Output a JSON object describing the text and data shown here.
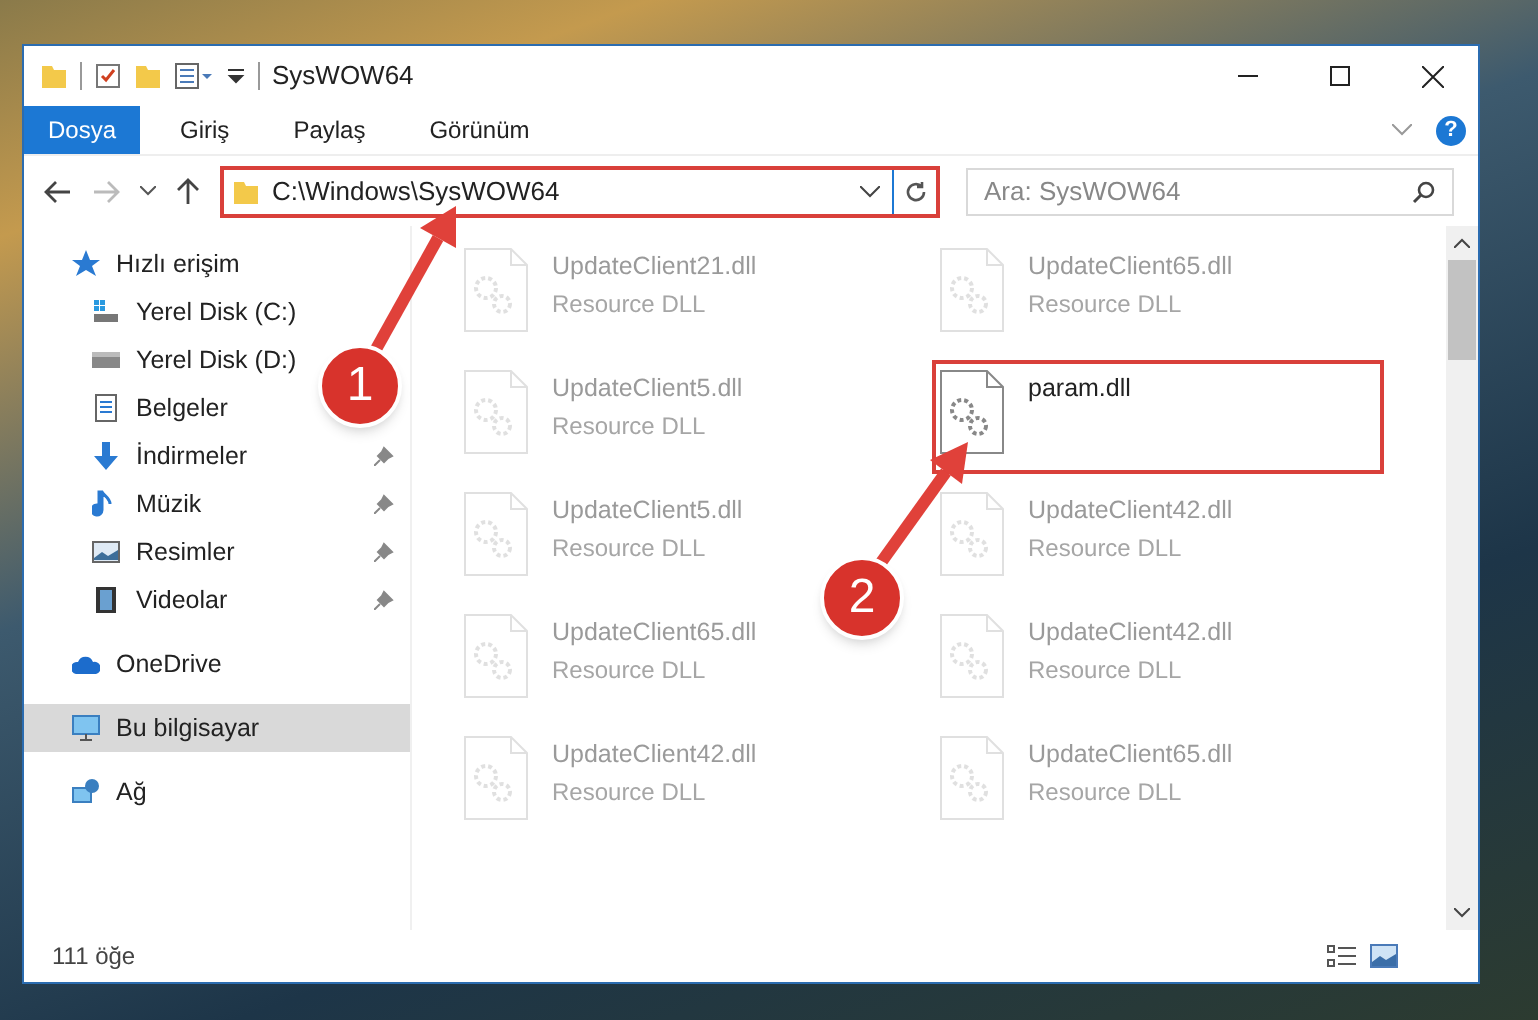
{
  "window": {
    "title": "SysWOW64"
  },
  "ribbon": {
    "tabs": [
      {
        "label": "Dosya",
        "selected": true
      },
      {
        "label": "Giriş",
        "selected": false
      },
      {
        "label": "Paylaş",
        "selected": false
      },
      {
        "label": "Görünüm",
        "selected": false
      }
    ],
    "help_label": "?"
  },
  "address_bar": {
    "path": "C:\\Windows\\SysWOW64",
    "highlighted": true
  },
  "search": {
    "placeholder": "Ara: SysWOW64"
  },
  "sidebar": {
    "items": [
      {
        "label": "Hızlı erişim",
        "kind": "star",
        "selected": false,
        "children": [
          {
            "label": "Yerel Disk (C:)",
            "kind": "system-drive",
            "pinned": false,
            "selected": false
          },
          {
            "label": "Yerel Disk (D:)",
            "kind": "drive",
            "pinned": false,
            "selected": false
          },
          {
            "label": "Belgeler",
            "kind": "document",
            "pinned": false,
            "selected": false
          },
          {
            "label": "İndirmeler",
            "kind": "download",
            "pinned": true,
            "selected": false
          },
          {
            "label": "Müzik",
            "kind": "music",
            "pinned": true,
            "selected": false
          },
          {
            "label": "Resimler",
            "kind": "picture",
            "pinned": true,
            "selected": false
          },
          {
            "label": "Videolar",
            "kind": "video",
            "pinned": true,
            "selected": false
          }
        ]
      },
      {
        "label": "OneDrive",
        "kind": "cloud",
        "selected": false
      },
      {
        "label": "Bu bilgisayar",
        "kind": "computer",
        "selected": true
      },
      {
        "label": "Ağ",
        "kind": "network",
        "selected": false
      }
    ]
  },
  "files": [
    {
      "name": "UpdateClient21.dll",
      "type": "Resource DLL",
      "dimmed": true,
      "highlighted": false
    },
    {
      "name": "UpdateClient65.dll",
      "type": "Resource DLL",
      "dimmed": true,
      "highlighted": false
    },
    {
      "name": "UpdateClient5.dll",
      "type": "Resource DLL",
      "dimmed": true,
      "highlighted": false
    },
    {
      "name": "param.dll",
      "dimmed": false,
      "highlighted": true
    },
    {
      "name": "UpdateClient5.dll",
      "type": "Resource DLL",
      "dimmed": true,
      "highlighted": false
    },
    {
      "name": "UpdateClient42.dll",
      "type": "Resource DLL",
      "dimmed": true,
      "highlighted": false
    },
    {
      "name": "UpdateClient65.dll",
      "type": "Resource DLL",
      "dimmed": true,
      "highlighted": false
    },
    {
      "name": "UpdateClient42.dll",
      "type": "Resource DLL",
      "dimmed": true,
      "highlighted": false
    },
    {
      "name": "UpdateClient42.dll",
      "type": "Resource DLL",
      "dimmed": true,
      "highlighted": false
    },
    {
      "name": "UpdateClient65.dll",
      "type": "Resource DLL",
      "dimmed": true,
      "highlighted": false
    }
  ],
  "status_bar": {
    "item_count": "111 öğe"
  },
  "annotations": [
    {
      "label": "1"
    },
    {
      "label": "2"
    }
  ]
}
